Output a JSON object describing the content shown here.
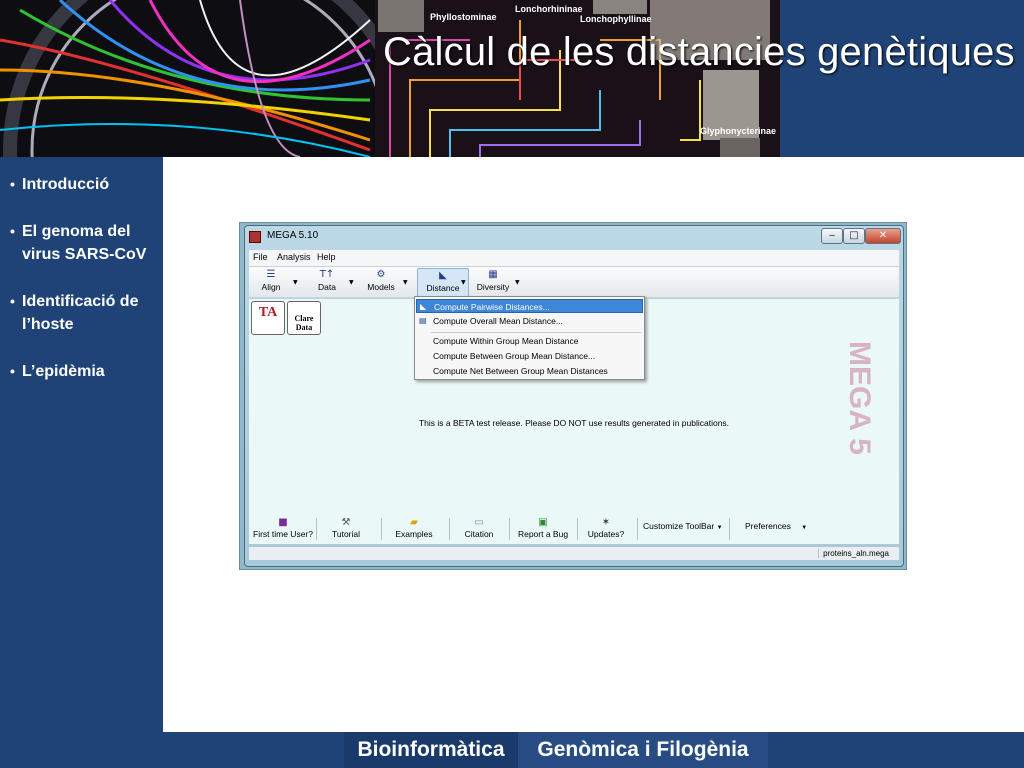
{
  "slide": {
    "title": "Càlcul de les distancies genètiques",
    "banner_labels": [
      "Phyllostominae",
      "Lonchorhininae",
      "Lonchophyllinae",
      "Glyphonycterinae"
    ]
  },
  "nav": {
    "items": [
      {
        "label": "Introducció",
        "current": false
      },
      {
        "label": "El genoma del virus SARS-CoV",
        "current": false
      },
      {
        "label": "Identificació de l’hoste",
        "current": false
      },
      {
        "label": "L’epidèmia",
        "current": true
      }
    ]
  },
  "footer": {
    "left": "Bioinformàtica",
    "right": "Genòmica i Filogènia"
  },
  "mega": {
    "window_title": "MEGA 5.10",
    "menu": [
      "File",
      "Analysis",
      "Help"
    ],
    "toolbar": [
      {
        "label": "Align",
        "icon": "align-icon"
      },
      {
        "label": "Data",
        "icon": "data-icon"
      },
      {
        "label": "Models",
        "icon": "models-icon"
      },
      {
        "label": "Distance",
        "icon": "distance-icon",
        "active": true
      },
      {
        "label": "Diversity",
        "icon": "diversity-icon"
      }
    ],
    "tiles": [
      "TA",
      "Clare Data"
    ],
    "watermark": "MEGA 5",
    "beta_notice": "This is a BETA test release. Please DO NOT use results generated in publications.",
    "bottom_toolbar": [
      {
        "label": "First time User?",
        "icon": "first-time-user-icon"
      },
      {
        "label": "Tutorial",
        "icon": "tutorial-icon"
      },
      {
        "label": "Examples",
        "icon": "examples-folder-icon"
      },
      {
        "label": "Citation",
        "icon": "citation-icon"
      },
      {
        "label": "Report a Bug",
        "icon": "report-bug-icon"
      },
      {
        "label": "Updates?",
        "icon": "updates-icon"
      },
      {
        "label": "Customize ToolBar",
        "icon": "customize-toolbar-icon"
      },
      {
        "label": "Preferences",
        "icon": "preferences-icon"
      }
    ],
    "status_file": "proteins_aln.mega",
    "distance_menu": [
      {
        "label": "Compute Pairwise Distances...",
        "selected": true
      },
      {
        "label": "Compute Overall Mean Distance...",
        "selected": false
      },
      {
        "label": "Compute Within Group Mean Distance",
        "selected": false
      },
      {
        "label": "Compute Between Group Mean Distance...",
        "selected": false
      },
      {
        "label": "Compute Net Between Group Mean Distances",
        "selected": false
      }
    ]
  },
  "colors": {
    "slide_blue": "#1f4377",
    "menu_highlight": "#3e86d8",
    "title_text": "#ffffff"
  }
}
